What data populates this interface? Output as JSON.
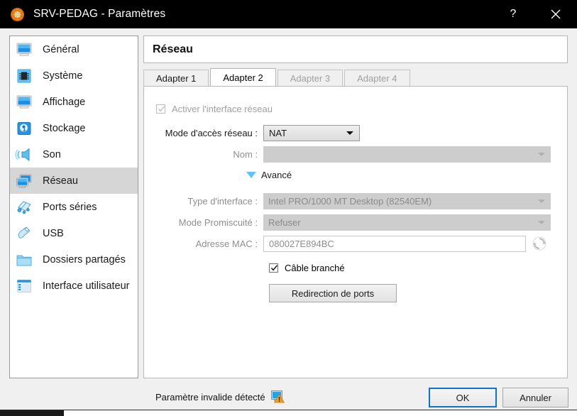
{
  "titlebar": {
    "title": "SRV-PEDAG - Paramètres",
    "app_icon": "virtualbox-icon",
    "help_label": "?",
    "close_label": "close-icon"
  },
  "sidebar": {
    "items": [
      {
        "label": "Général",
        "icon": "monitor-icon",
        "selected": false
      },
      {
        "label": "Système",
        "icon": "chip-icon",
        "selected": false
      },
      {
        "label": "Affichage",
        "icon": "display-icon",
        "selected": false
      },
      {
        "label": "Stockage",
        "icon": "harddisk-icon",
        "selected": false
      },
      {
        "label": "Son",
        "icon": "speaker-icon",
        "selected": false
      },
      {
        "label": "Réseau",
        "icon": "network-icon",
        "selected": true
      },
      {
        "label": "Ports séries",
        "icon": "serialport-icon",
        "selected": false
      },
      {
        "label": "USB",
        "icon": "usb-icon",
        "selected": false
      },
      {
        "label": "Dossiers partagés",
        "icon": "folder-icon",
        "selected": false
      },
      {
        "label": "Interface utilisateur",
        "icon": "userinterface-icon",
        "selected": false
      }
    ]
  },
  "panel": {
    "header_title": "Réseau",
    "tabs": [
      {
        "label": "Adapter 1",
        "state": "normal"
      },
      {
        "label": "Adapter 2",
        "state": "active"
      },
      {
        "label": "Adapter 3",
        "state": "disabled"
      },
      {
        "label": "Adapter 4",
        "state": "disabled"
      }
    ],
    "enable_adapter": {
      "label": "Activer l'interface réseau",
      "checked": true,
      "enabled": false
    },
    "attached_to": {
      "label": "Mode d'accès réseau :",
      "value": "NAT",
      "enabled": true
    },
    "name": {
      "label": "Nom :",
      "value": "",
      "enabled": false
    },
    "advanced": {
      "label": "Avancé",
      "expanded": true,
      "triangle_color": "#5fc4f5"
    },
    "adapter_type": {
      "label": "Type d'interface :",
      "value": "Intel PRO/1000 MT Desktop (82540EM)",
      "enabled": false
    },
    "promiscuous_mode": {
      "label": "Mode Promiscuité :",
      "value": "Refuser",
      "enabled": false
    },
    "mac_address": {
      "label": "Adresse MAC :",
      "value": "080027E894BC",
      "enabled": false,
      "refresh_icon": "refresh-mac-icon"
    },
    "cable_connected": {
      "label": "Câble branché",
      "checked": true,
      "enabled": true
    },
    "port_forwarding_button": {
      "label": "Redirection de ports"
    }
  },
  "footer": {
    "invalid_message": "Paramètre invalide détecté",
    "invalid_icon": "warning-monitor-icon",
    "ok_label": "OK",
    "cancel_label": "Annuler"
  },
  "colors": {
    "accent": "#0c74cf",
    "titlebar_bg": "#000000",
    "window_bg": "#f0f0f0",
    "selection_bg": "#d6d6d6",
    "warning": "#f0a030"
  }
}
